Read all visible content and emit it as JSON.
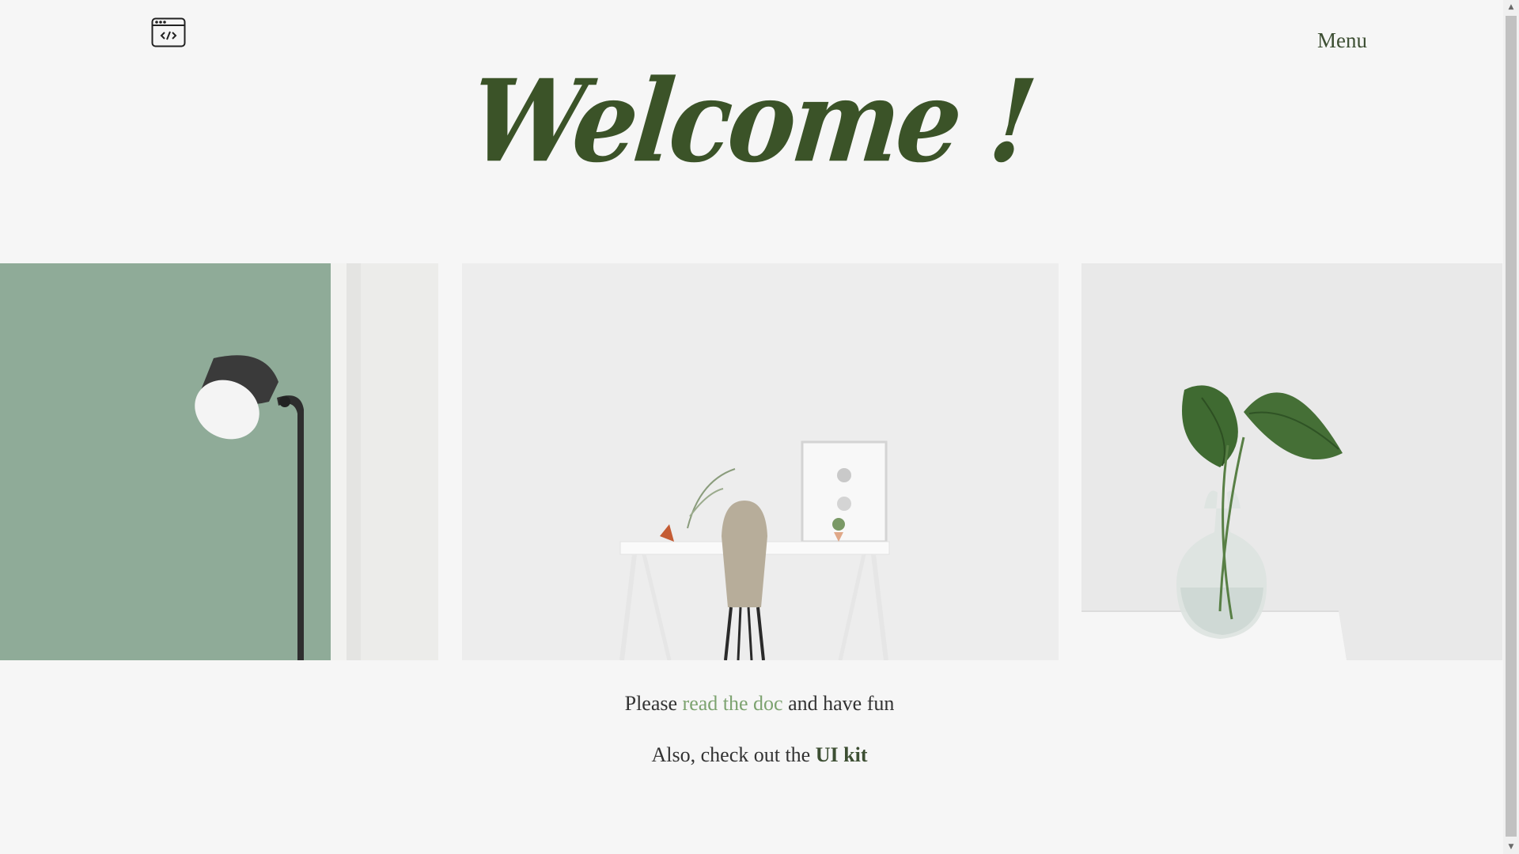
{
  "header": {
    "logo_icon": "browser-code-icon",
    "menu_label": "Menu"
  },
  "hero": {
    "title": "Welcome !"
  },
  "gallery": {
    "images": [
      {
        "subject": "floor lamp against green wall"
      },
      {
        "subject": "white desk with chair and frame"
      },
      {
        "subject": "leaves in glass vase"
      }
    ]
  },
  "footer": {
    "line1_prefix": "Please ",
    "line1_link": "read the doc",
    "line1_suffix": " and have fun",
    "line2_prefix": "Also, check out the ",
    "line2_link": "UI kit"
  },
  "colors": {
    "background": "#f6f6f6",
    "accent_green": "#7da370",
    "dark_green": "#3b5328",
    "text": "#333333"
  },
  "scrollbar": {
    "up_icon": "arrow-up-icon",
    "down_icon": "arrow-down-icon"
  }
}
